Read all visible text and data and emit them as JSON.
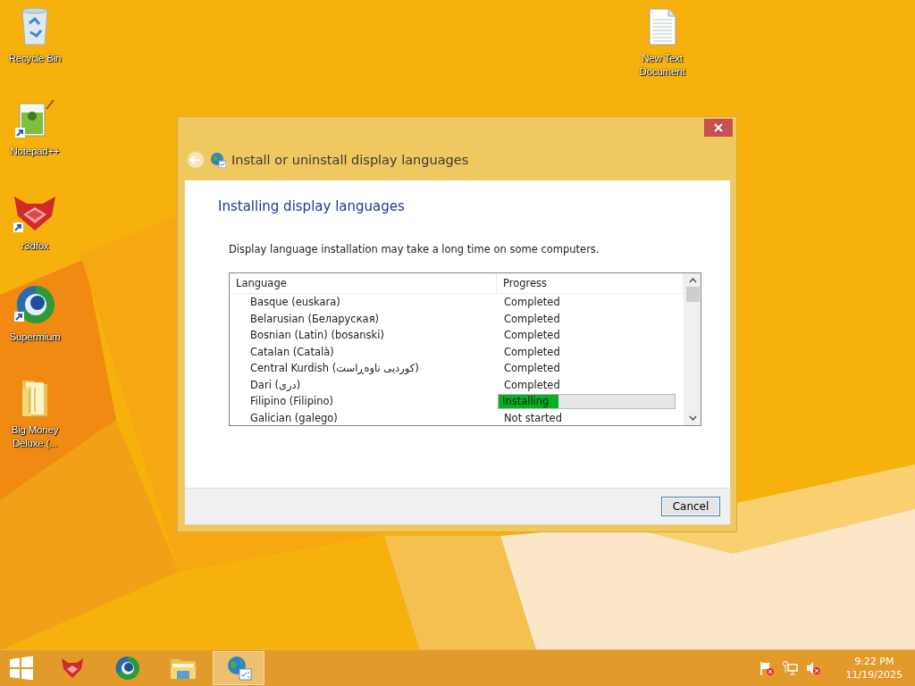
{
  "desktop_icons": [
    {
      "label": "Recycle Bin"
    },
    {
      "label": "Notepad++"
    },
    {
      "label": "r3dfox"
    },
    {
      "label": "Supermium"
    },
    {
      "label": "Big Money Deluxe (..."
    },
    {
      "label": "New Text Document"
    }
  ],
  "window": {
    "title": "Install or uninstall display languages",
    "heading": "Installing display languages",
    "description": "Display language installation may take a long time on some computers.",
    "table": {
      "columns": [
        "Language",
        "Progress"
      ],
      "rows": [
        {
          "kind": "text",
          "language": "Basque (euskara)",
          "progress": "Completed"
        },
        {
          "kind": "text",
          "language": "Belarusian (Беларуская)",
          "progress": "Completed"
        },
        {
          "kind": "text",
          "language": "Bosnian (Latin) (bosanski)",
          "progress": "Completed"
        },
        {
          "kind": "text",
          "language": "Catalan (Català)",
          "progress": "Completed"
        },
        {
          "kind": "text",
          "language": "Central Kurdish (کوردیی ناوەڕاست)",
          "progress": "Completed"
        },
        {
          "kind": "text",
          "language": "Dari (درى)",
          "progress": "Completed"
        },
        {
          "kind": "bar",
          "language": "Filipino (Filipino)",
          "progress": "Installing",
          "level": 0.34
        },
        {
          "kind": "text",
          "language": "Galician (galego)",
          "progress": "Not started"
        }
      ]
    },
    "buttons": [
      "Cancel"
    ]
  },
  "taskbar": {
    "items": [
      {
        "selected": false
      },
      {
        "selected": false
      },
      {
        "selected": false
      },
      {
        "selected": true
      }
    ],
    "clock": {
      "time": "9:22 PM",
      "date": "11/19/2025"
    }
  }
}
